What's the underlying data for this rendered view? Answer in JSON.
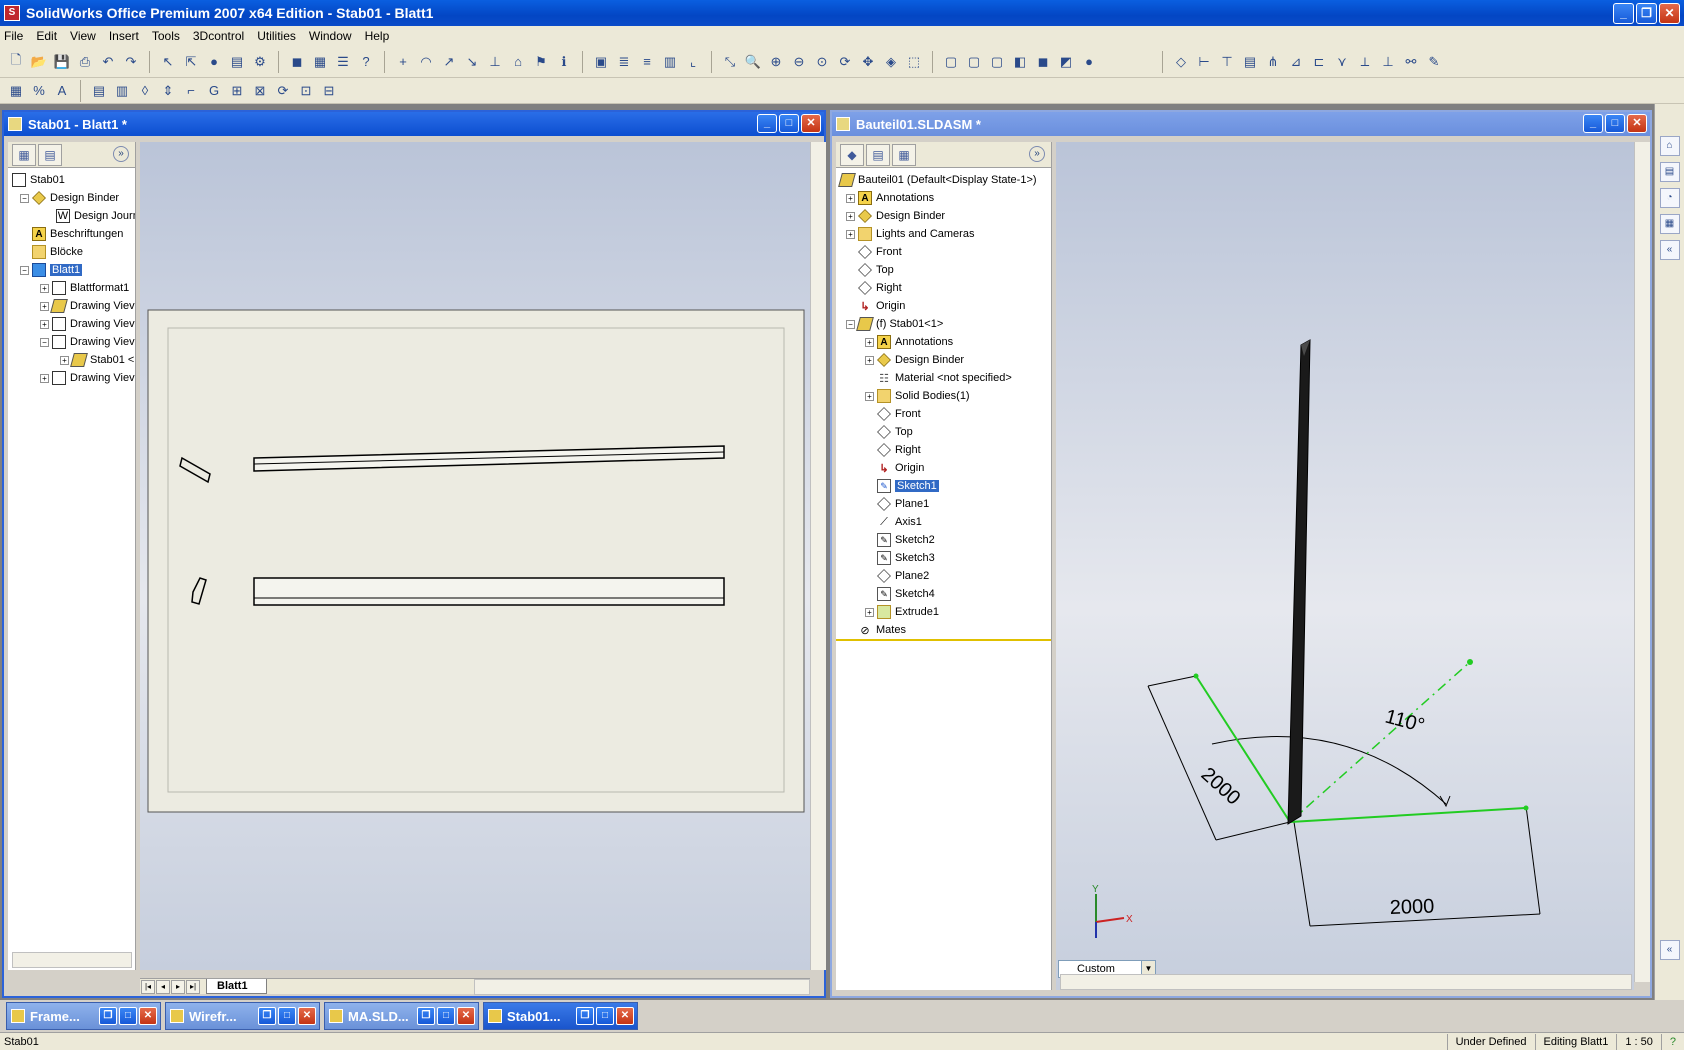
{
  "app": {
    "title": "SolidWorks Office Premium 2007 x64 Edition - Stab01 - Blatt1"
  },
  "menu": [
    "File",
    "Edit",
    "View",
    "Insert",
    "Tools",
    "3Dcontrol",
    "Utilities",
    "Window",
    "Help"
  ],
  "drawing_window": {
    "title": "Stab01 - Blatt1 *",
    "tree": {
      "root": "Stab01",
      "design_binder": "Design Binder",
      "design_journal": "Design Journ",
      "beschriftungen": "Beschriftungen",
      "bloecke": "Blöcke",
      "blatt1": "Blatt1",
      "blattformat": "Blattformat1",
      "view1": "Drawing Viev",
      "view2": "Drawing Viev",
      "view3": "Drawing Viev",
      "stab_ref": "Stab01 <",
      "view4": "Drawing Viev"
    },
    "sheet_tab": "Blatt1"
  },
  "assembly_window": {
    "title": "Bauteil01.SLDASM *",
    "tree": {
      "root": "Bauteil01  (Default<Display State-1>)",
      "annotations": "Annotations",
      "design_binder": "Design Binder",
      "lights": "Lights and Cameras",
      "front": "Front",
      "top": "Top",
      "right": "Right",
      "origin": "Origin",
      "stab": "(f) Stab01<1>",
      "sub_annotations": "Annotations",
      "sub_binder": "Design Binder",
      "material": "Material <not specified>",
      "solid_bodies": "Solid Bodies(1)",
      "sub_front": "Front",
      "sub_top": "Top",
      "sub_right": "Right",
      "sub_origin": "Origin",
      "sketch1": "Sketch1",
      "plane1": "Plane1",
      "axis1": "Axis1",
      "sketch2": "Sketch2",
      "sketch3": "Sketch3",
      "plane2": "Plane2",
      "sketch4": "Sketch4",
      "extrude1": "Extrude1",
      "mates": "Mates"
    },
    "dimensions": {
      "angle": "110°",
      "length_a": "2000",
      "length_b": "2000"
    },
    "view_orientation": "Custom",
    "axis_label_x": "X",
    "axis_label_y": "Y"
  },
  "taskbar": [
    {
      "label": "Frame..."
    },
    {
      "label": "Wirefr..."
    },
    {
      "label": "MA.SLD..."
    },
    {
      "label": "Stab01..."
    }
  ],
  "status": {
    "left": "Stab01",
    "state": "Under Defined",
    "editing": "Editing Blatt1",
    "scale": "1 : 50"
  },
  "colors": {
    "accent": "#0a5fe0",
    "sketch_line": "#22cc22",
    "beam": "#1a1a1a"
  }
}
